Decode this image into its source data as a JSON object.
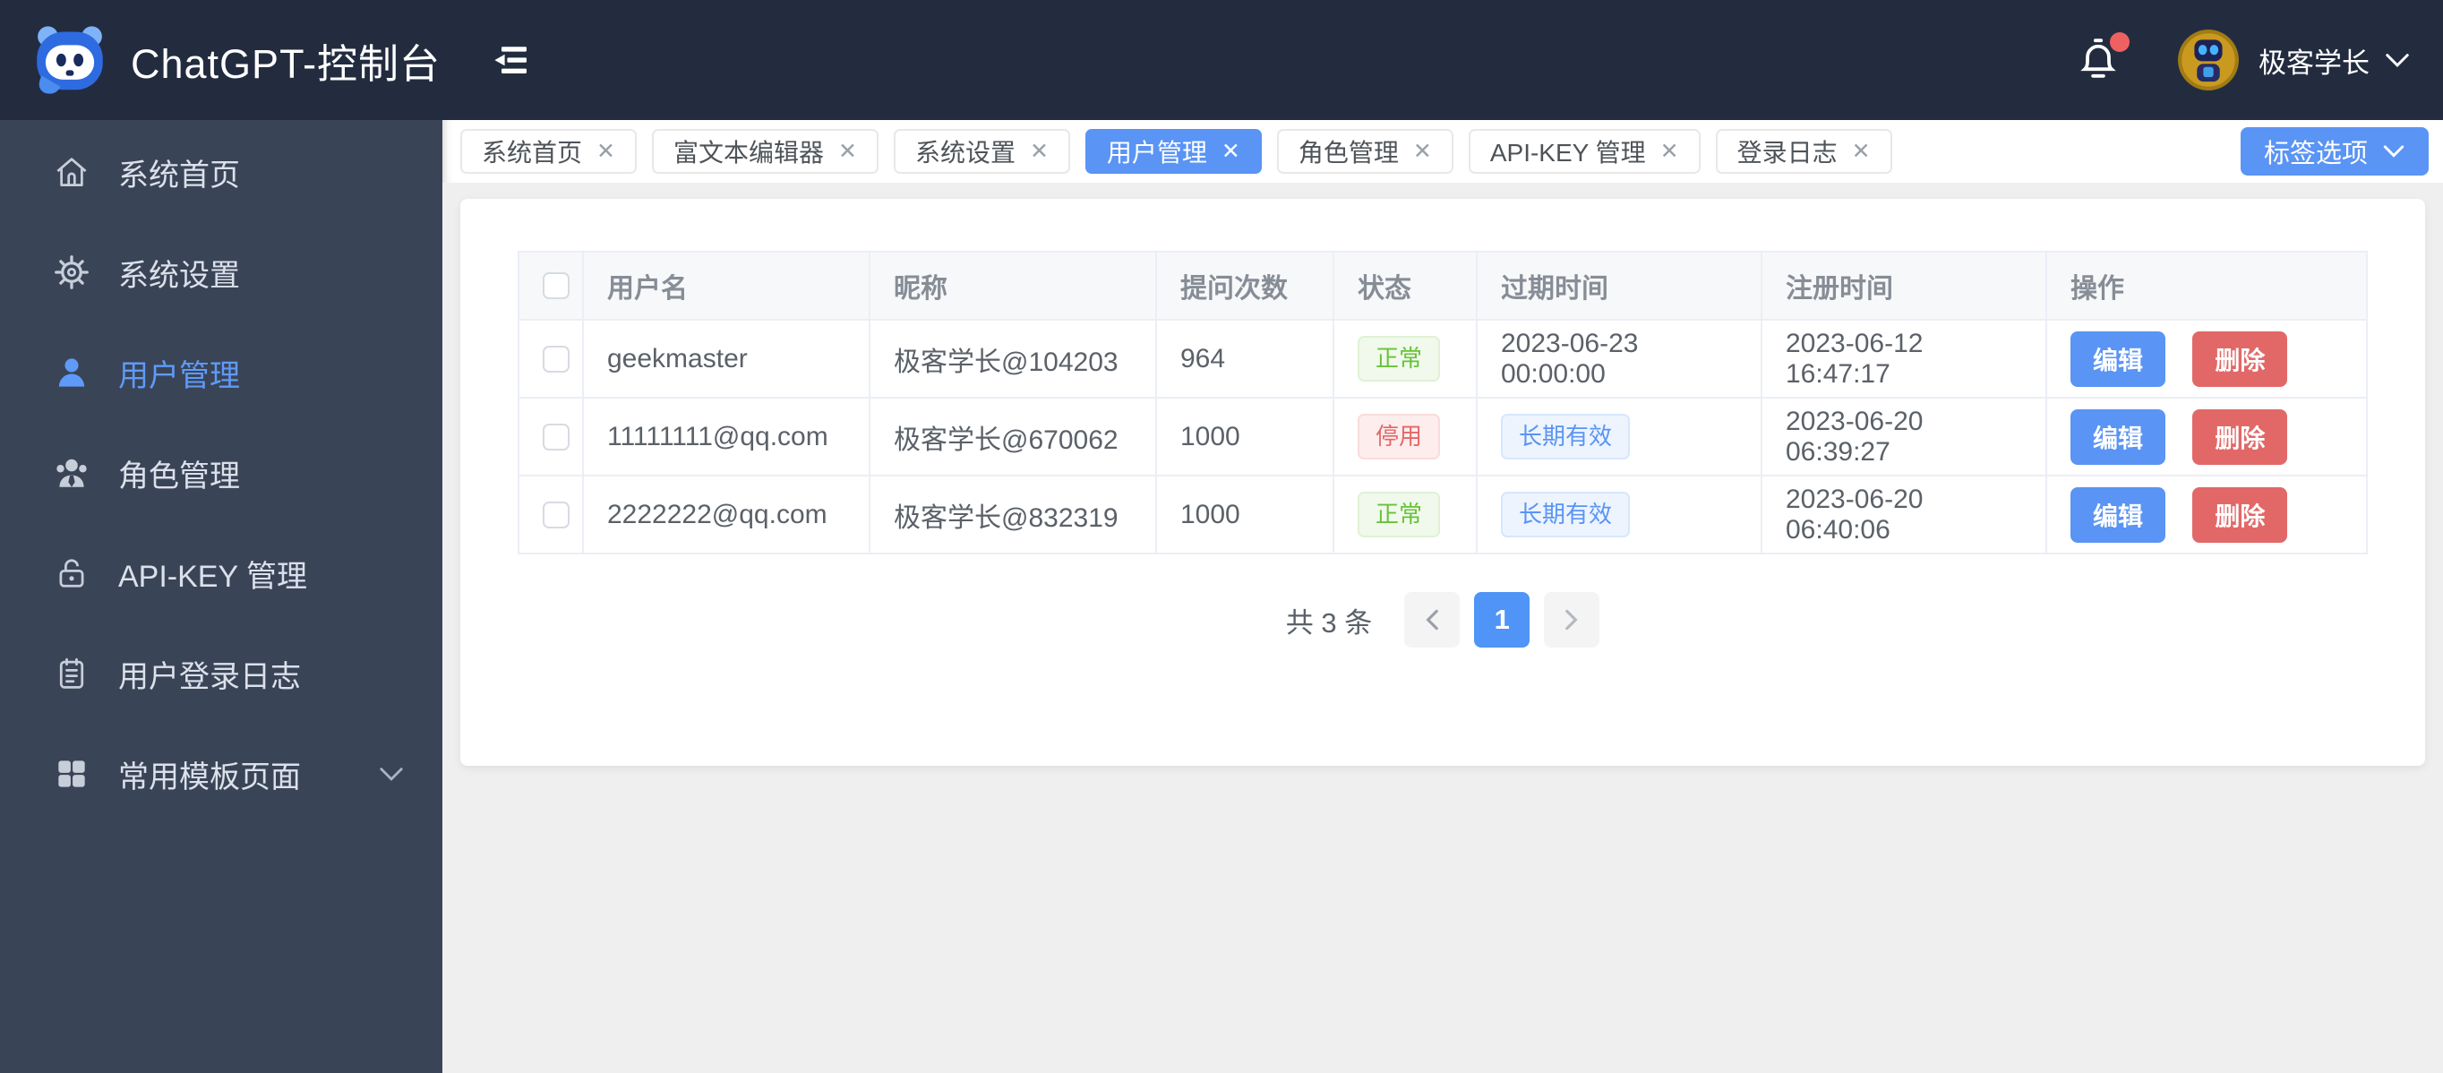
{
  "app": {
    "title": "ChatGPT-控制台"
  },
  "header": {
    "user_name": "极客学长"
  },
  "icons": {
    "close": "✕"
  },
  "colors": {
    "header_bg": "#232c3f",
    "sidebar_bg": "#3a4457",
    "page_bg": "#efefef",
    "primary": "#5a94f4",
    "danger": "#e26868",
    "success": "#67c23a",
    "notification_dot": "#ef6161"
  },
  "sidebar": {
    "items": [
      {
        "label": "系统首页",
        "icon": "home-icon",
        "active": false
      },
      {
        "label": "系统设置",
        "icon": "gear-icon",
        "active": false
      },
      {
        "label": "用户管理",
        "icon": "user-icon",
        "active": true
      },
      {
        "label": "角色管理",
        "icon": "roles-icon",
        "active": false
      },
      {
        "label": "API-KEY 管理",
        "icon": "lock-icon",
        "active": false
      },
      {
        "label": "用户登录日志",
        "icon": "log-icon",
        "active": false
      },
      {
        "label": "常用模板页面",
        "icon": "grid-icon",
        "active": false,
        "expandable": true
      }
    ]
  },
  "tabbar": {
    "tabs": [
      {
        "label": "系统首页",
        "active": false
      },
      {
        "label": "富文本编辑器",
        "active": false
      },
      {
        "label": "系统设置",
        "active": false
      },
      {
        "label": "用户管理",
        "active": true
      },
      {
        "label": "角色管理",
        "active": false
      },
      {
        "label": "API-KEY 管理",
        "active": false
      },
      {
        "label": "登录日志",
        "active": false
      }
    ],
    "options_button": "标签选项"
  },
  "table": {
    "columns": {
      "username": "用户名",
      "nickname": "昵称",
      "ask_count": "提问次数",
      "status": "状态",
      "expire_time": "过期时间",
      "register_time": "注册时间",
      "actions": "操作"
    },
    "action_labels": {
      "edit": "编辑",
      "delete": "删除"
    },
    "rows": [
      {
        "username": "geekmaster",
        "nickname": "极客学长@104203",
        "ask_count": "964",
        "status": "正常",
        "status_type": "success",
        "expire": "2023-06-23 00:00:00",
        "expire_type": "text",
        "registered": "2023-06-12 16:47:17"
      },
      {
        "username": "11111111@qq.com",
        "nickname": "极客学长@670062",
        "ask_count": "1000",
        "status": "停用",
        "status_type": "danger",
        "expire": "长期有效",
        "expire_type": "badge",
        "registered": "2023-06-20 06:39:27"
      },
      {
        "username": "2222222@qq.com",
        "nickname": "极客学长@832319",
        "ask_count": "1000",
        "status": "正常",
        "status_type": "success",
        "expire": "长期有效",
        "expire_type": "badge",
        "registered": "2023-06-20 06:40:06"
      }
    ]
  },
  "pagination": {
    "total_text": "共 3 条",
    "current_page": "1"
  }
}
